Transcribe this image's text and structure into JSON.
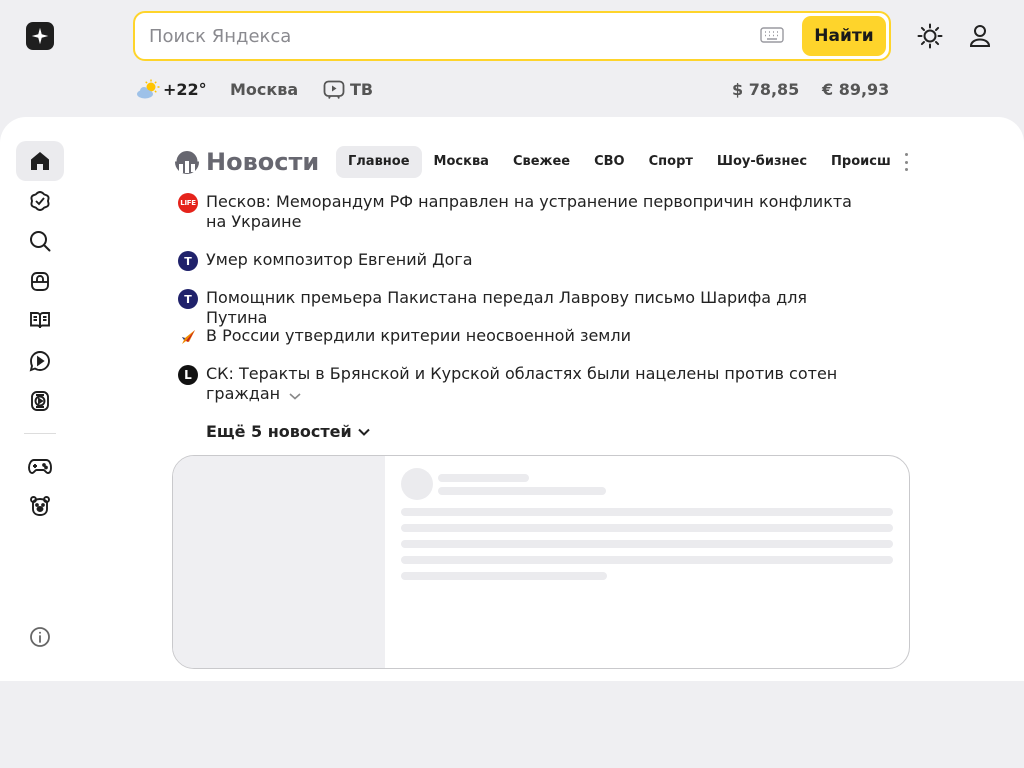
{
  "header": {
    "search_placeholder": "Поиск Яндекса",
    "search_value": "",
    "search_button": "Найти",
    "accent_color": "#fed42b",
    "icons": [
      "yandex-star-icon",
      "keyboard-icon",
      "theme-sun-icon",
      "user-icon"
    ]
  },
  "info": {
    "weather_temp": "+22°",
    "weather_icon": "sun-cloud-icon",
    "city": "Москва",
    "tv_label": "ТВ",
    "usd_rate": "$ 78,85",
    "eur_rate": "€ 89,93"
  },
  "sidebar": {
    "items": [
      {
        "icon": "home-icon"
      },
      {
        "icon": "check-badge-icon"
      },
      {
        "icon": "search-icon"
      },
      {
        "icon": "market-bag-icon"
      },
      {
        "icon": "book-icon"
      },
      {
        "icon": "video-play-icon"
      },
      {
        "icon": "tv-play-icon"
      },
      {
        "icon": "gamepad-icon"
      },
      {
        "icon": "bear-icon"
      },
      {
        "icon": "info-icon"
      }
    ]
  },
  "news": {
    "title": "Новости",
    "tabs": [
      "Главное",
      "Москва",
      "Свежее",
      "СВО",
      "Спорт",
      "Шоу-бизнес",
      "Происшествия"
    ],
    "items": [
      {
        "text": "Песков: Меморандум РФ направлен на устранение первопричин конфликта на Украине",
        "source_label": "LIFE",
        "source_color": "#e5231b"
      },
      {
        "text": "Умер композитор Евгений Дога",
        "source_label": "Т",
        "source_color": "#20226b"
      },
      {
        "text": "Помощник премьера Пакистана передал Лаврову письмо Шарифа для Путина",
        "source_label": "Т",
        "source_color": "#20226b"
      },
      {
        "text": "В России утвердили критерии неосвоенной земли",
        "source_label": "",
        "source_color": "#f08a00"
      },
      {
        "text": "СК: Теракты в Брянской и Курской областях были нацелены против сотен граждан",
        "source_label": "L",
        "source_color": "#111111"
      }
    ],
    "more_label": "Ещё 5 новостей"
  }
}
